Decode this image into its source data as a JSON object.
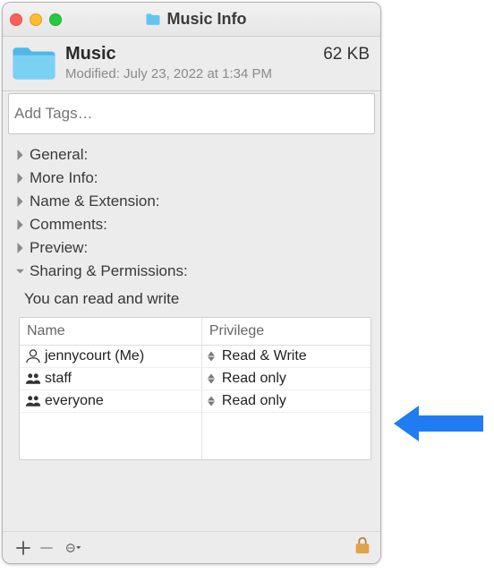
{
  "titlebar": {
    "title": "Music Info"
  },
  "header": {
    "name": "Music",
    "modified_label": "Modified:",
    "modified_value": "July 23, 2022 at 1:34 PM",
    "size": "62 KB"
  },
  "tags": {
    "placeholder": "Add Tags…"
  },
  "sections": {
    "general": "General:",
    "more_info": "More Info:",
    "name_ext": "Name & Extension:",
    "comments": "Comments:",
    "preview": "Preview:",
    "sharing": "Sharing & Permissions:"
  },
  "permissions": {
    "note": "You can read and write",
    "columns": {
      "name": "Name",
      "privilege": "Privilege"
    },
    "rows": [
      {
        "user": "jennycourt (Me)",
        "icon": "person",
        "privilege": "Read & Write"
      },
      {
        "user": "staff",
        "icon": "group",
        "privilege": "Read only"
      },
      {
        "user": "everyone",
        "icon": "group",
        "privilege": "Read only"
      }
    ]
  },
  "colors": {
    "folder": "#63c5ef",
    "arrow": "#1f7cf3",
    "lock": "#e2a24a"
  }
}
